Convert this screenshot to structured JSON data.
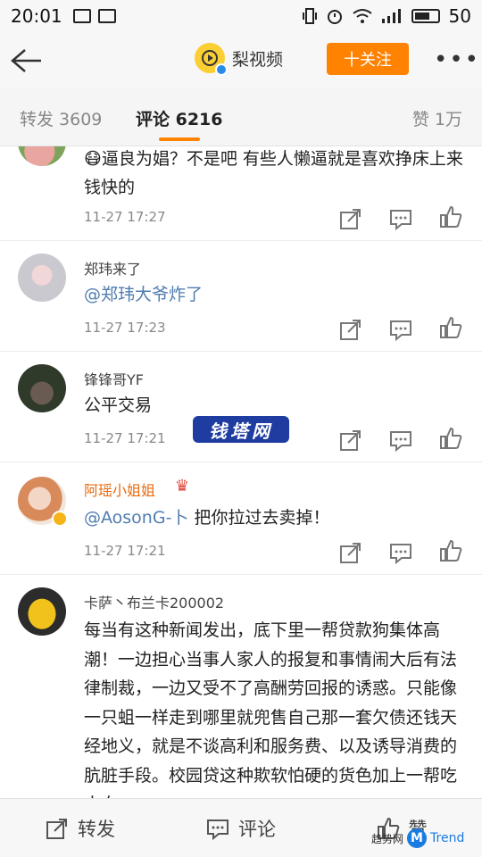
{
  "status_bar": {
    "time": "20:01",
    "battery": "50"
  },
  "header": {
    "account_name": "梨视频",
    "follow_label": "十关注",
    "more": "•••"
  },
  "tabs": {
    "repost": "转发 3609",
    "comments": "评论 6216",
    "likes": "赞 1万"
  },
  "comments": [
    {
      "nick": "",
      "content": "逼良为娼？不是吧  有些人懒逼就是喜欢挣床上来钱快的",
      "emoji": "😷",
      "time": "11-27 17:27"
    },
    {
      "nick": "郑玮来了",
      "content": "@郑玮大爷炸了",
      "time": "11-27 17:23"
    },
    {
      "nick": "锋锋哥YF",
      "content": "公平交易",
      "time": "11-27 17:21"
    },
    {
      "nick": "阿瑶小姐姐",
      "mention": "@AosonG-卜",
      "content": " 把你拉过去卖掉！",
      "time": "11-27 17:21"
    },
    {
      "nick": "卡萨丶布兰卡200002",
      "content": "每当有这种新闻发出，底下里一帮贷款狗集体高潮！一边担心当事人家人的报复和事情闹大后有法律制裁，一边又受不了高酬劳回报的诱惑。只能像一只蛆一样走到哪里就兜售自己那一套欠债还钱天经地义，就是不谈高利和服务费、以及诱导消费的肮脏手段。校园贷这种欺软怕硬的货色加上一帮吃人血"
    }
  ],
  "watermark": "钱塔网",
  "bottom": {
    "repost": "转发",
    "comment": "评论",
    "like": "赞",
    "mark_text": "趋势网",
    "mark_letter": "M",
    "mark_brand": "Trend"
  },
  "colors": {
    "accent": "#ff8200",
    "mention": "#507daf"
  }
}
